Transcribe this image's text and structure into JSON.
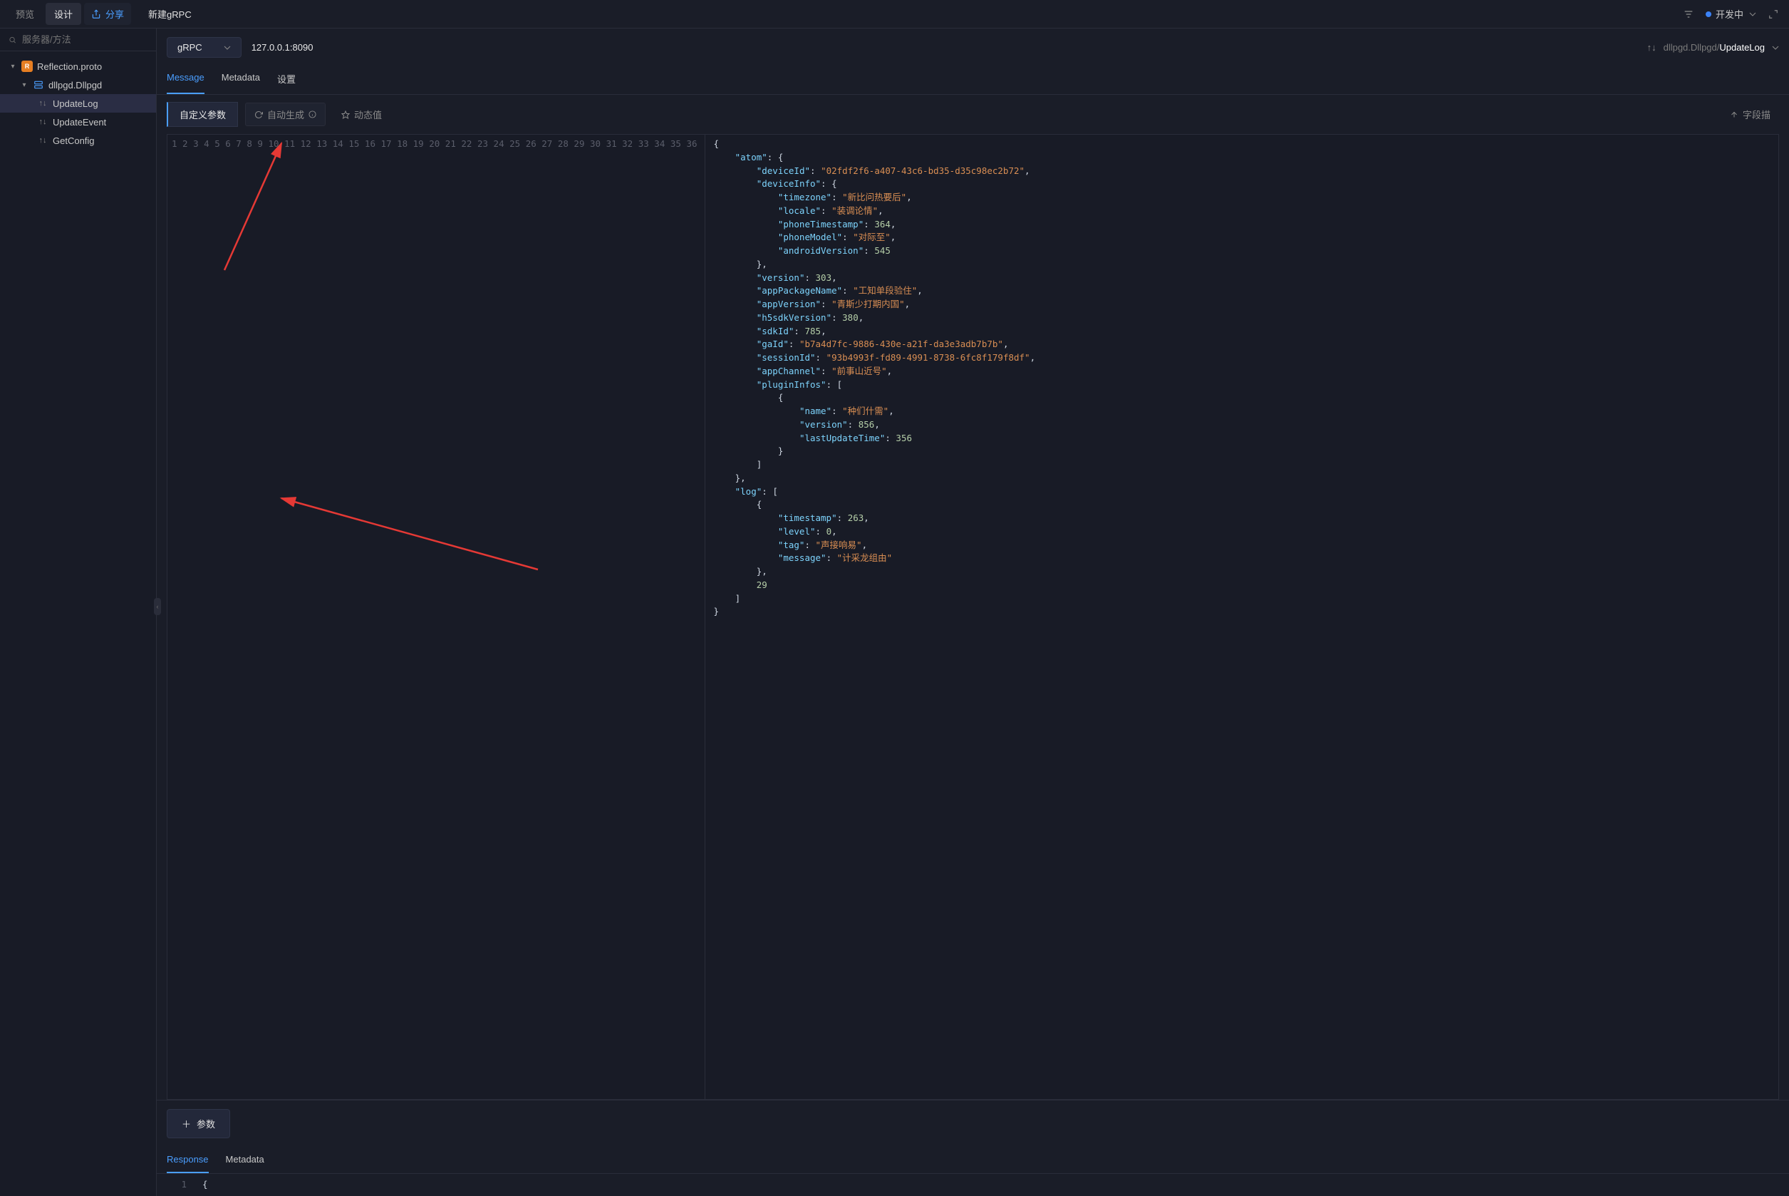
{
  "topbar": {
    "preview": "预览",
    "design": "设计",
    "share": "分享",
    "title": "新建gRPC",
    "status": "开发中"
  },
  "sidebar": {
    "search_placeholder": "服务器/方法",
    "proto_file": "Reflection.proto",
    "service": "dllpgd.Dllpgd",
    "methods": {
      "m1": "UpdateLog",
      "m2": "UpdateEvent",
      "m3": "GetConfig"
    }
  },
  "addrbar": {
    "grpc": "gRPC",
    "address": "127.0.0.1:8090",
    "path_gray": "dllpgd.Dllpgd/",
    "path_bold": "UpdateLog"
  },
  "msg_tabs": {
    "message": "Message",
    "metadata": "Metadata",
    "settings": "设置"
  },
  "toolbar": {
    "custom": "自定义参数",
    "autogen": "自动生成",
    "dynamic": "动态值",
    "fielddesc": "字段描"
  },
  "editor": {
    "line_count": 36,
    "code_lines": [
      {
        "indent": 0,
        "t": [
          {
            "c": "punc",
            "v": "{"
          }
        ]
      },
      {
        "indent": 1,
        "t": [
          {
            "c": "key",
            "v": "\"atom\""
          },
          {
            "c": "punc",
            "v": ": {"
          }
        ]
      },
      {
        "indent": 2,
        "t": [
          {
            "c": "key",
            "v": "\"deviceId\""
          },
          {
            "c": "punc",
            "v": ": "
          },
          {
            "c": "str",
            "v": "\"02fdf2f6-a407-43c6-bd35-d35c98ec2b72\""
          },
          {
            "c": "punc",
            "v": ","
          }
        ]
      },
      {
        "indent": 2,
        "t": [
          {
            "c": "key",
            "v": "\"deviceInfo\""
          },
          {
            "c": "punc",
            "v": ": {"
          }
        ]
      },
      {
        "indent": 3,
        "t": [
          {
            "c": "key",
            "v": "\"timezone\""
          },
          {
            "c": "punc",
            "v": ": "
          },
          {
            "c": "str",
            "v": "\"新比问热要后\""
          },
          {
            "c": "punc",
            "v": ","
          }
        ]
      },
      {
        "indent": 3,
        "t": [
          {
            "c": "key",
            "v": "\"locale\""
          },
          {
            "c": "punc",
            "v": ": "
          },
          {
            "c": "str",
            "v": "\"装调论情\""
          },
          {
            "c": "punc",
            "v": ","
          }
        ]
      },
      {
        "indent": 3,
        "t": [
          {
            "c": "key",
            "v": "\"phoneTimestamp\""
          },
          {
            "c": "punc",
            "v": ": "
          },
          {
            "c": "num",
            "v": "364"
          },
          {
            "c": "punc",
            "v": ","
          }
        ]
      },
      {
        "indent": 3,
        "t": [
          {
            "c": "key",
            "v": "\"phoneModel\""
          },
          {
            "c": "punc",
            "v": ": "
          },
          {
            "c": "str",
            "v": "\"对际至\""
          },
          {
            "c": "punc",
            "v": ","
          }
        ]
      },
      {
        "indent": 3,
        "t": [
          {
            "c": "key",
            "v": "\"androidVersion\""
          },
          {
            "c": "punc",
            "v": ": "
          },
          {
            "c": "num",
            "v": "545"
          }
        ]
      },
      {
        "indent": 2,
        "t": [
          {
            "c": "punc",
            "v": "},"
          }
        ]
      },
      {
        "indent": 2,
        "t": [
          {
            "c": "key",
            "v": "\"version\""
          },
          {
            "c": "punc",
            "v": ": "
          },
          {
            "c": "num",
            "v": "303"
          },
          {
            "c": "punc",
            "v": ","
          }
        ]
      },
      {
        "indent": 2,
        "t": [
          {
            "c": "key",
            "v": "\"appPackageName\""
          },
          {
            "c": "punc",
            "v": ": "
          },
          {
            "c": "str",
            "v": "\"工知单段验住\""
          },
          {
            "c": "punc",
            "v": ","
          }
        ]
      },
      {
        "indent": 2,
        "t": [
          {
            "c": "key",
            "v": "\"appVersion\""
          },
          {
            "c": "punc",
            "v": ": "
          },
          {
            "c": "str",
            "v": "\"青斯少打期内国\""
          },
          {
            "c": "punc",
            "v": ","
          }
        ]
      },
      {
        "indent": 2,
        "t": [
          {
            "c": "key",
            "v": "\"h5sdkVersion\""
          },
          {
            "c": "punc",
            "v": ": "
          },
          {
            "c": "num",
            "v": "380"
          },
          {
            "c": "punc",
            "v": ","
          }
        ]
      },
      {
        "indent": 2,
        "t": [
          {
            "c": "key",
            "v": "\"sdkId\""
          },
          {
            "c": "punc",
            "v": ": "
          },
          {
            "c": "num",
            "v": "785"
          },
          {
            "c": "punc",
            "v": ","
          }
        ]
      },
      {
        "indent": 2,
        "t": [
          {
            "c": "key",
            "v": "\"gaId\""
          },
          {
            "c": "punc",
            "v": ": "
          },
          {
            "c": "str",
            "v": "\"b7a4d7fc-9886-430e-a21f-da3e3adb7b7b\""
          },
          {
            "c": "punc",
            "v": ","
          }
        ]
      },
      {
        "indent": 2,
        "t": [
          {
            "c": "key",
            "v": "\"sessionId\""
          },
          {
            "c": "punc",
            "v": ": "
          },
          {
            "c": "str",
            "v": "\"93b4993f-fd89-4991-8738-6fc8f179f8df\""
          },
          {
            "c": "punc",
            "v": ","
          }
        ]
      },
      {
        "indent": 2,
        "t": [
          {
            "c": "key",
            "v": "\"appChannel\""
          },
          {
            "c": "punc",
            "v": ": "
          },
          {
            "c": "str",
            "v": "\"前事山近号\""
          },
          {
            "c": "punc",
            "v": ","
          }
        ]
      },
      {
        "indent": 2,
        "t": [
          {
            "c": "key",
            "v": "\"pluginInfos\""
          },
          {
            "c": "punc",
            "v": ": ["
          }
        ]
      },
      {
        "indent": 3,
        "t": [
          {
            "c": "punc",
            "v": "{"
          }
        ]
      },
      {
        "indent": 4,
        "t": [
          {
            "c": "key",
            "v": "\"name\""
          },
          {
            "c": "punc",
            "v": ": "
          },
          {
            "c": "str",
            "v": "\"种们什需\""
          },
          {
            "c": "punc",
            "v": ","
          }
        ]
      },
      {
        "indent": 4,
        "t": [
          {
            "c": "key",
            "v": "\"version\""
          },
          {
            "c": "punc",
            "v": ": "
          },
          {
            "c": "num",
            "v": "856"
          },
          {
            "c": "punc",
            "v": ","
          }
        ]
      },
      {
        "indent": 4,
        "t": [
          {
            "c": "key",
            "v": "\"lastUpdateTime\""
          },
          {
            "c": "punc",
            "v": ": "
          },
          {
            "c": "num",
            "v": "356"
          }
        ]
      },
      {
        "indent": 3,
        "t": [
          {
            "c": "punc",
            "v": "}"
          }
        ]
      },
      {
        "indent": 2,
        "t": [
          {
            "c": "punc",
            "v": "]"
          }
        ]
      },
      {
        "indent": 1,
        "t": [
          {
            "c": "punc",
            "v": "},"
          }
        ]
      },
      {
        "indent": 1,
        "t": [
          {
            "c": "key",
            "v": "\"log\""
          },
          {
            "c": "punc",
            "v": ": ["
          }
        ]
      },
      {
        "indent": 2,
        "t": [
          {
            "c": "punc",
            "v": "{"
          }
        ]
      },
      {
        "indent": 3,
        "t": [
          {
            "c": "key",
            "v": "\"timestamp\""
          },
          {
            "c": "punc",
            "v": ": "
          },
          {
            "c": "num",
            "v": "263"
          },
          {
            "c": "punc",
            "v": ","
          }
        ]
      },
      {
        "indent": 3,
        "t": [
          {
            "c": "key",
            "v": "\"level\""
          },
          {
            "c": "punc",
            "v": ": "
          },
          {
            "c": "num",
            "v": "0"
          },
          {
            "c": "punc",
            "v": ","
          }
        ]
      },
      {
        "indent": 3,
        "t": [
          {
            "c": "key",
            "v": "\"tag\""
          },
          {
            "c": "punc",
            "v": ": "
          },
          {
            "c": "str",
            "v": "\"声接响易\""
          },
          {
            "c": "punc",
            "v": ","
          }
        ]
      },
      {
        "indent": 3,
        "t": [
          {
            "c": "key",
            "v": "\"message\""
          },
          {
            "c": "punc",
            "v": ": "
          },
          {
            "c": "str",
            "v": "\"计采龙组由\""
          }
        ]
      },
      {
        "indent": 2,
        "t": [
          {
            "c": "punc",
            "v": "},"
          }
        ]
      },
      {
        "indent": 2,
        "t": [
          {
            "c": "num",
            "v": "29"
          }
        ]
      },
      {
        "indent": 1,
        "t": [
          {
            "c": "punc",
            "v": "]"
          }
        ]
      },
      {
        "indent": 0,
        "t": [
          {
            "c": "punc",
            "v": "}"
          }
        ]
      }
    ]
  },
  "bottom": {
    "param": "参数"
  },
  "response": {
    "tab_resp": "Response",
    "tab_meta": "Metadata",
    "line1": "1",
    "body": "{"
  }
}
